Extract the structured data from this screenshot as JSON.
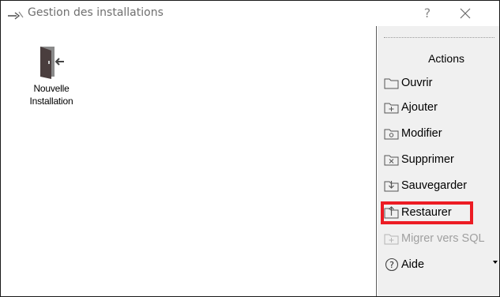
{
  "window": {
    "title": "Gestion des installations",
    "help_label": "?",
    "close_label": "✕"
  },
  "items": [
    {
      "label": "Nouvelle\nInstallation",
      "icon": "door-enter-icon"
    }
  ],
  "actions": {
    "header": "Actions",
    "list": [
      {
        "label": "Ouvrir",
        "icon": "folder-open-icon",
        "enabled": true
      },
      {
        "label": "Ajouter",
        "icon": "folder-add-icon",
        "enabled": true
      },
      {
        "label": "Modifier",
        "icon": "folder-edit-icon",
        "enabled": true
      },
      {
        "label": "Supprimer",
        "icon": "folder-delete-icon",
        "enabled": true
      },
      {
        "label": "Sauvegarder",
        "icon": "folder-save-icon",
        "enabled": true
      },
      {
        "label": "Restaurer",
        "icon": "folder-restore-icon",
        "enabled": true,
        "highlighted": true
      },
      {
        "label": "Migrer vers SQL",
        "icon": "folder-migrate-icon",
        "enabled": false
      },
      {
        "label": "Aide",
        "icon": "help-circle-icon",
        "enabled": true
      }
    ]
  },
  "colors": {
    "highlight": "#ec1c24",
    "actions_bg": "#f0f0f0",
    "disabled_text": "#a0a0a0"
  }
}
